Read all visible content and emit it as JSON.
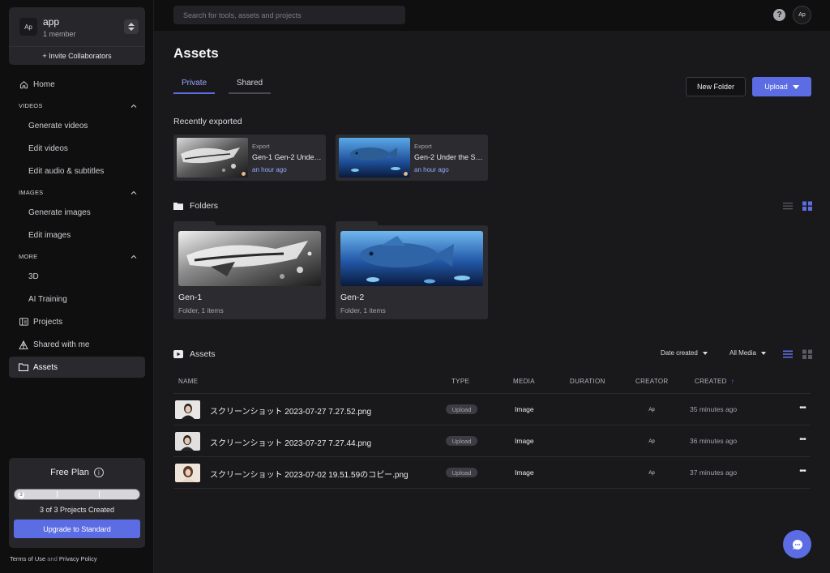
{
  "workspace": {
    "avatar": "Ap",
    "name": "app",
    "members": "1 member",
    "invite": "+ Invite Collaborators"
  },
  "nav": {
    "home": "Home",
    "videos_section": "VIDEOS",
    "generate_videos": "Generate videos",
    "edit_videos": "Edit videos",
    "edit_audio": "Edit audio & subtitles",
    "images_section": "IMAGES",
    "generate_images": "Generate images",
    "edit_images": "Edit images",
    "more_section": "MORE",
    "three_d": "3D",
    "ai_training": "AI Training",
    "projects": "Projects",
    "shared": "Shared with me",
    "assets": "Assets"
  },
  "plan": {
    "title": "Free Plan",
    "progress_value": 3,
    "progress_max": 3,
    "count": "3 of 3 Projects Created",
    "upgrade": "Upgrade to Standard"
  },
  "legal": {
    "terms": "Terms of Use",
    "and": "and",
    "privacy": "Privacy Policy"
  },
  "topbar": {
    "search_placeholder": "Search for tools, assets and projects",
    "help": "?",
    "avatar": "Ap"
  },
  "page": {
    "title": "Assets"
  },
  "tabs": {
    "private": "Private",
    "shared": "Shared"
  },
  "actions": {
    "new_folder": "New Folder",
    "upload": "Upload"
  },
  "recent": {
    "label": "Recently exported",
    "items": [
      {
        "kind": "Export",
        "name": "Gen-1 Gen-2 Unde…",
        "time": "an hour ago"
      },
      {
        "kind": "Export",
        "name": "Gen-2 Under the S…",
        "time": "an hour ago"
      }
    ]
  },
  "folders": {
    "label": "Folders",
    "items": [
      {
        "name": "Gen-1",
        "meta": "Folder, 1 items"
      },
      {
        "name": "Gen-2",
        "meta": "Folder, 1 items"
      }
    ]
  },
  "assets": {
    "label": "Assets",
    "sort": "Date created",
    "media_filter": "All Media",
    "columns": {
      "name": "NAME",
      "type": "TYPE",
      "media": "MEDIA",
      "duration": "DURATION",
      "creator": "CREATOR",
      "created": "CREATED",
      "sort_arrow": "↑"
    },
    "rows": [
      {
        "name": "スクリーンショット 2023-07-27 7.27.52.png",
        "type": "Upload",
        "media": "Image",
        "creator": "Ap",
        "created": "35 minutes ago",
        "more": "•••"
      },
      {
        "name": "スクリーンショット 2023-07-27 7.27.44.png",
        "type": "Upload",
        "media": "Image",
        "creator": "Ap",
        "created": "36 minutes ago",
        "more": "•••"
      },
      {
        "name": "スクリーンショット 2023-07-02 19.51.59のコピー.png",
        "type": "Upload",
        "media": "Image",
        "creator": "Ap",
        "created": "37 minutes ago",
        "more": "•••"
      }
    ]
  },
  "colors": {
    "accent": "#5c6de3",
    "accent_text": "#9aa6ff",
    "background": "#19191b",
    "sidebar": "#0f0f10",
    "card": "#2b2b30"
  }
}
